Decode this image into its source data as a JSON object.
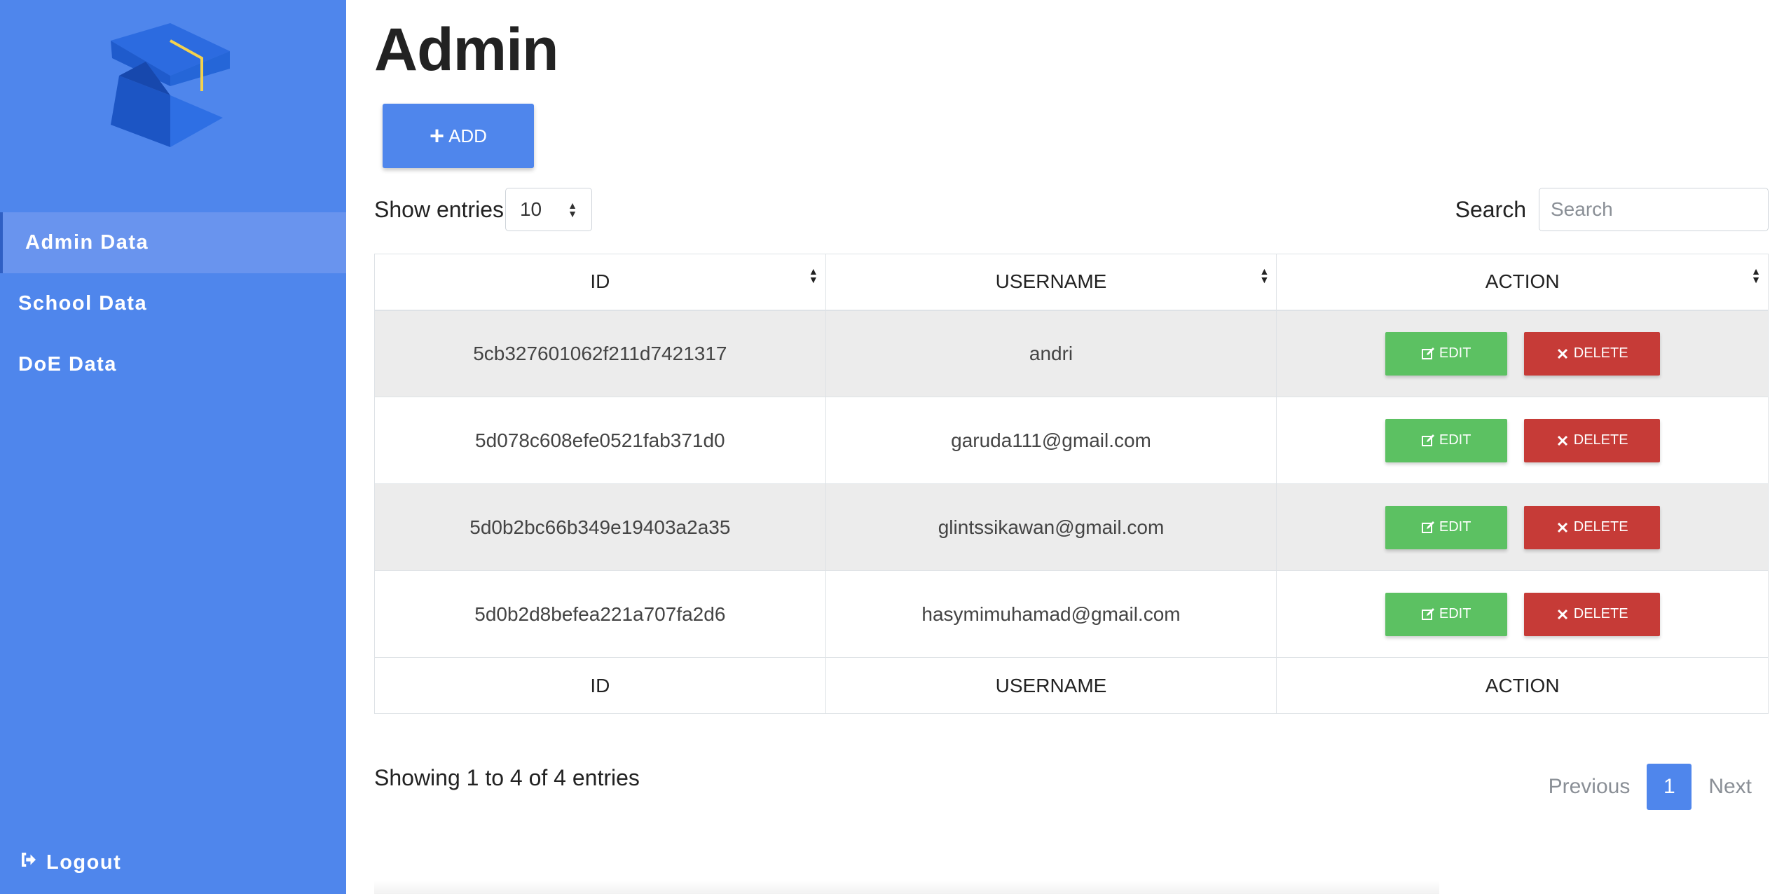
{
  "sidebar": {
    "items": [
      {
        "label": "Admin Data",
        "active": true
      },
      {
        "label": "School Data",
        "active": false
      },
      {
        "label": "DoE Data",
        "active": false
      }
    ],
    "logout_label": "Logout"
  },
  "page": {
    "title": "Admin",
    "add_label": "ADD"
  },
  "controls": {
    "show_entries_label": "Show entries",
    "entries_value": "10",
    "search_label": "Search",
    "search_placeholder": "Search"
  },
  "table": {
    "headers": [
      "ID",
      "USERNAME",
      "ACTION"
    ],
    "rows": [
      {
        "id": "5cb327601062f211d7421317",
        "username": "andri"
      },
      {
        "id": "5d078c608efe0521fab371d0",
        "username": "garuda111@gmail.com"
      },
      {
        "id": "5d0b2bc66b349e19403a2a35",
        "username": "glintssikawan@gmail.com"
      },
      {
        "id": "5d0b2d8befea221a707fa2d6",
        "username": "hasymimuhamad@gmail.com"
      }
    ],
    "edit_label": "EDIT",
    "delete_label": "DELETE"
  },
  "footer": {
    "info": "Showing 1 to 4 of 4 entries",
    "previous_label": "Previous",
    "current_page": "1",
    "next_label": "Next"
  },
  "colors": {
    "sidebar": "#4f86ec",
    "edit": "#5cc162",
    "delete": "#c63b37"
  }
}
